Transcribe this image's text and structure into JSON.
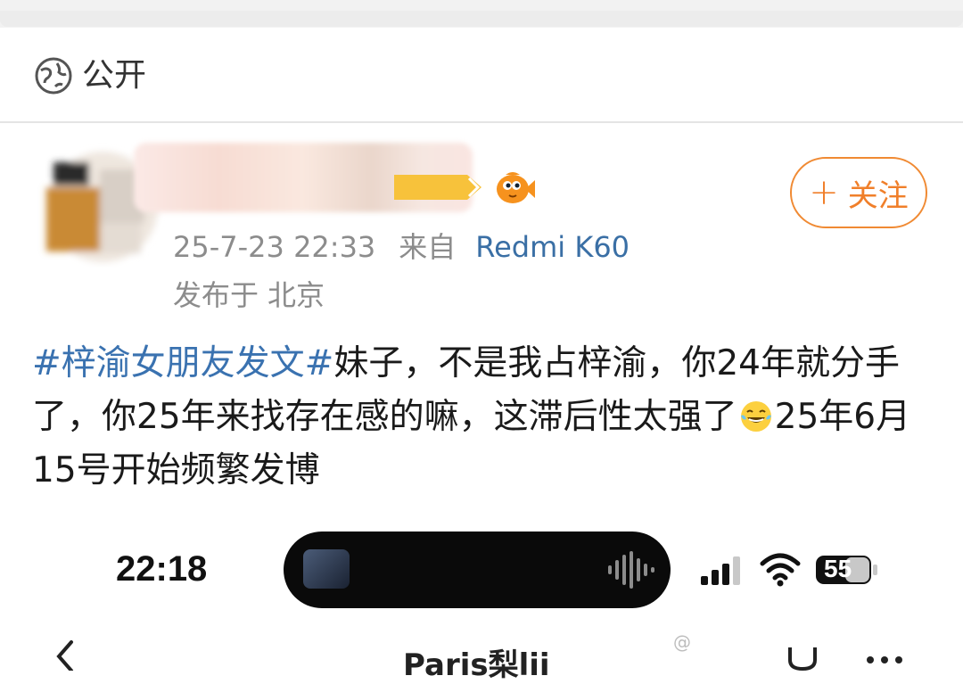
{
  "visibility": {
    "label": "公开",
    "icon": "globe-icon"
  },
  "author": {
    "avatar": "avatar",
    "name_redacted": true,
    "badges": [
      "level-badge-icon",
      "fish-icon"
    ]
  },
  "follow": {
    "plus": "+",
    "label": "关注"
  },
  "meta": {
    "datetime": "25-7-23 22:33",
    "source_label": "来自",
    "device": "Redmi K60",
    "location_label": "发布于",
    "location": "北京"
  },
  "post": {
    "hashtag": "#梓渝女朋友发文#",
    "text1": "妹子，不是我占梓渝，你24年就分手了，你25年来找存在感的嘛，这滞后性太强了",
    "emoji": "laugh-cry-emoji",
    "text2": "25年6月15号开始频繁发博"
  },
  "screenshot": {
    "time": "22:18",
    "battery": "55",
    "header_title": "Paris梨lii",
    "watermark": "@"
  },
  "colors": {
    "accent": "#f07f2a",
    "link": "#3a72b0",
    "meta": "#8c8c8c"
  }
}
